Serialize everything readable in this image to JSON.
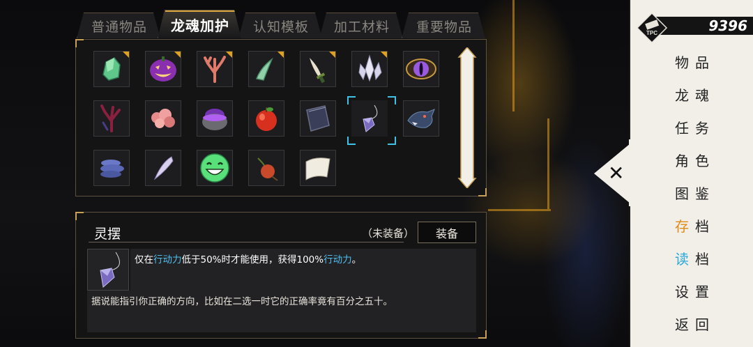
{
  "tabs": [
    {
      "label": "普通物品",
      "active": false
    },
    {
      "label": "龙魂加护",
      "active": true
    },
    {
      "label": "认知模板",
      "active": false
    },
    {
      "label": "加工材料",
      "active": false
    },
    {
      "label": "重要物品",
      "active": false
    }
  ],
  "items": [
    {
      "name": "green-crystal",
      "new": true
    },
    {
      "name": "jack-o-lantern",
      "new": true
    },
    {
      "name": "coral",
      "new": true
    },
    {
      "name": "horn",
      "new": true
    },
    {
      "name": "dagger",
      "new": true
    },
    {
      "name": "crystal-cluster",
      "new": true
    },
    {
      "name": "purple-eye",
      "new": false
    },
    {
      "name": "dark-coral",
      "new": false
    },
    {
      "name": "pink-fungus",
      "new": false
    },
    {
      "name": "potion-cauldron",
      "new": false
    },
    {
      "name": "apple",
      "new": false
    },
    {
      "name": "notebook",
      "new": false
    },
    {
      "name": "pendulum",
      "new": false,
      "selected": true
    },
    {
      "name": "dragon-head",
      "new": false
    },
    {
      "name": "blue-fungus",
      "new": false
    },
    {
      "name": "fang",
      "new": false
    },
    {
      "name": "smiley-face",
      "new": false
    },
    {
      "name": "rosehip",
      "new": false
    },
    {
      "name": "scroll",
      "new": false
    }
  ],
  "detail": {
    "name": "灵摆",
    "status": "（未装备）",
    "equip_label": "装备",
    "desc1_pre": "仅在",
    "desc1_hl1": "行动力",
    "desc1_mid": "低于50%时才能使用，获得100%",
    "desc1_hl2": "行动力",
    "desc1_post": "。",
    "desc2": "据说能指引你正确的方向，比如在二选一时它的正确率竟有百分之五十。"
  },
  "currency": {
    "icon": "tpc-icon",
    "badge_text": "TPC",
    "amount": "9396"
  },
  "menu": [
    {
      "first": "物",
      "rest": "品",
      "color": "#222222"
    },
    {
      "first": "龙",
      "rest": "魂",
      "color": "#222222"
    },
    {
      "first": "任",
      "rest": "务",
      "color": "#222222"
    },
    {
      "first": "角",
      "rest": "色",
      "color": "#222222"
    },
    {
      "first": "图",
      "rest": "鉴",
      "color": "#222222"
    },
    {
      "first": "存",
      "rest": "档",
      "color": "#e08a1a"
    },
    {
      "first": "读",
      "rest": "档",
      "color": "#2aa8d8"
    },
    {
      "first": "设",
      "rest": "置",
      "color": "#222222"
    },
    {
      "first": "返",
      "rest": "回",
      "color": "#222222"
    }
  ],
  "colors": {
    "accent_gold": "#d9a640",
    "select_cyan": "#3fc2e6",
    "highlight_blue": "#4fc0f0",
    "save_orange": "#e08a1a",
    "load_blue": "#2aa8d8"
  }
}
